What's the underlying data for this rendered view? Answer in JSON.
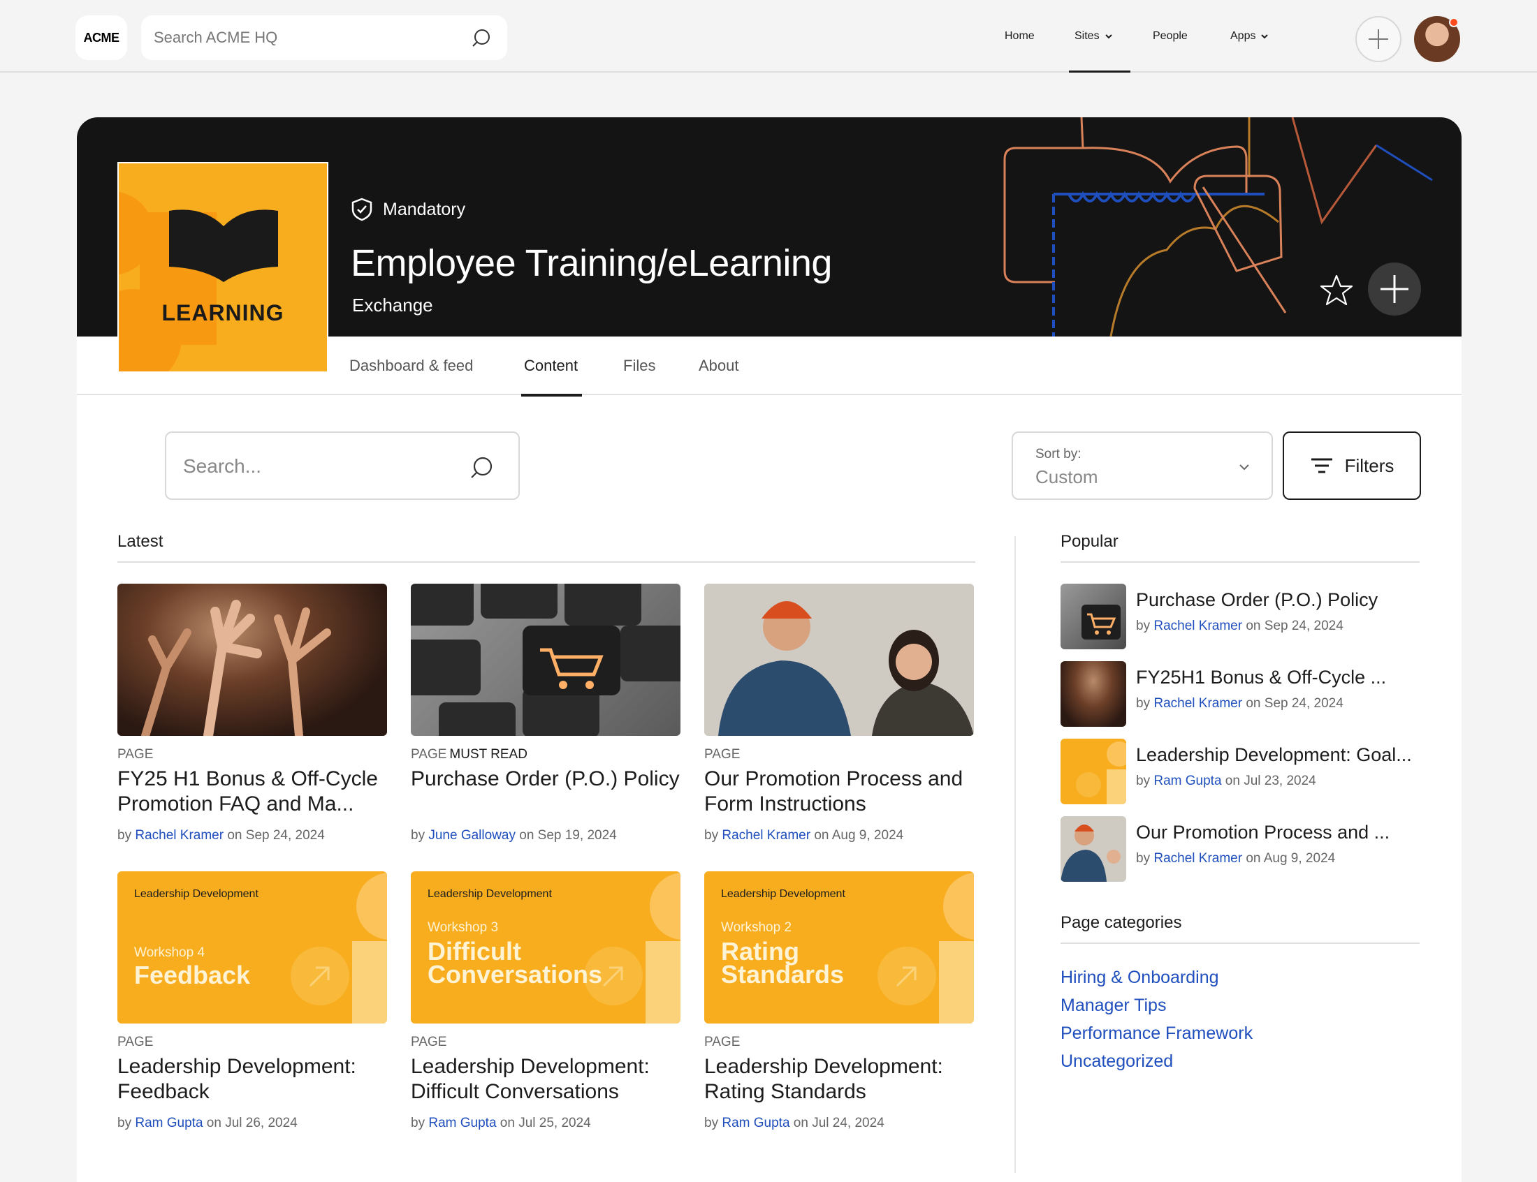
{
  "topbar": {
    "logo": "ACME",
    "search_placeholder": "Search ACME HQ",
    "nav": [
      {
        "label": "Home"
      },
      {
        "label": "Sites"
      },
      {
        "label": "People"
      },
      {
        "label": "Apps"
      }
    ]
  },
  "site": {
    "logo_word": "LEARNING",
    "badge": "Mandatory",
    "title": "Employee Training/eLearning",
    "subtitle": "Exchange"
  },
  "tabs": [
    "Dashboard & feed",
    "Content",
    "Files",
    "About"
  ],
  "content": {
    "search_placeholder": "Search...",
    "sort_label": "Sort by:",
    "sort_value": "Custom",
    "filters_label": "Filters",
    "latest_heading": "Latest",
    "popular_heading": "Popular",
    "categories_heading": "Page categories"
  },
  "latest": [
    {
      "kind": "PAGE",
      "tag": "",
      "title": "FY25 H1 Bonus & Off-Cycle Promotion FAQ and Ma...",
      "by": "by",
      "author": "Rachel Kramer",
      "on": "on Sep 24, 2024"
    },
    {
      "kind": "PAGE",
      "tag": "MUST READ",
      "title": "Purchase Order (P.O.) Policy",
      "by": "by",
      "author": "June Galloway",
      "on": "on Sep 19, 2024"
    },
    {
      "kind": "PAGE",
      "tag": "",
      "title": "Our Promotion Process and Form Instructions",
      "by": "by",
      "author": "Rachel Kramer",
      "on": "on Aug 9, 2024"
    },
    {
      "kind": "PAGE",
      "tag": "",
      "title": "Leadership Development: Feedback",
      "by": "by",
      "author": "Ram Gupta",
      "on": "on Jul 26, 2024",
      "thumb": {
        "cat": "Leadership Development",
        "ws": "Workshop 4",
        "big": "Feedback"
      }
    },
    {
      "kind": "PAGE",
      "tag": "",
      "title": "Leadership Development: Difficult Conversations",
      "by": "by",
      "author": "Ram Gupta",
      "on": "on Jul 25, 2024",
      "thumb": {
        "cat": "Leadership Development",
        "ws": "Workshop 3",
        "big": "Difficult Conversations"
      }
    },
    {
      "kind": "PAGE",
      "tag": "",
      "title": "Leadership Development: Rating Standards",
      "by": "by",
      "author": "Ram Gupta",
      "on": "on Jul 24, 2024",
      "thumb": {
        "cat": "Leadership Development",
        "ws": "Workshop 2",
        "big": "Rating Standards"
      }
    }
  ],
  "popular": [
    {
      "title": "Purchase Order (P.O.) Policy",
      "by": "by",
      "author": "Rachel Kramer",
      "on": "on Sep 24, 2024"
    },
    {
      "title": "FY25H1 Bonus & Off-Cycle ...",
      "by": "by",
      "author": "Rachel Kramer",
      "on": "on Sep 24, 2024"
    },
    {
      "title": "Leadership Development: Goal...",
      "by": "by",
      "author": "Ram Gupta",
      "on": "on Jul 23, 2024"
    },
    {
      "title": "Our Promotion Process and ...",
      "by": "by",
      "author": "Rachel Kramer",
      "on": "on Aug 9, 2024"
    }
  ],
  "categories": [
    "Hiring & Onboarding",
    "Manager Tips",
    "Performance Framework",
    "Uncategorized"
  ],
  "colors": {
    "accent": "#f8ad1e",
    "link": "#1f4ebd",
    "banner": "#141414"
  }
}
